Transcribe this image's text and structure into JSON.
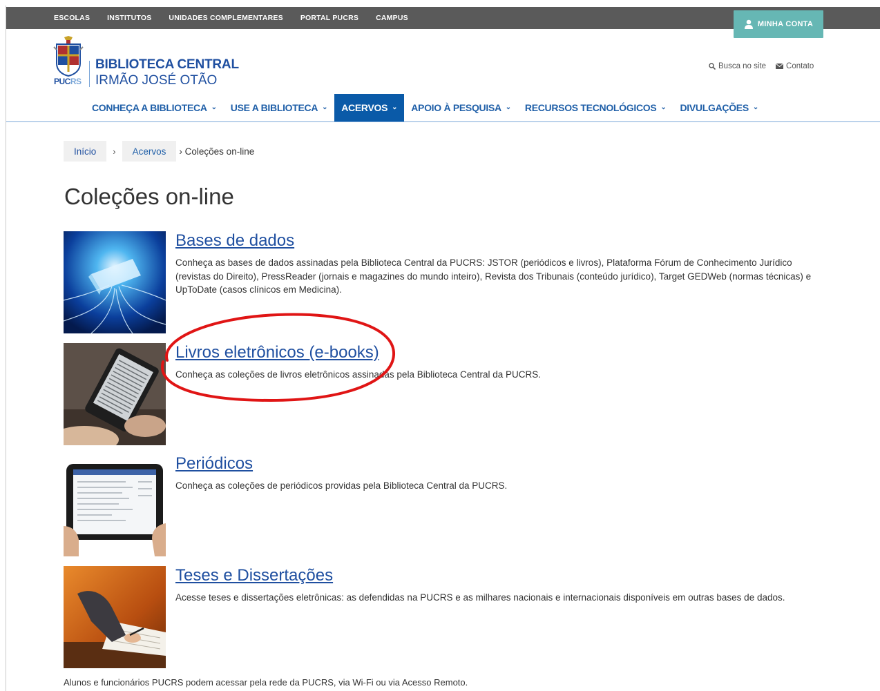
{
  "topbar": {
    "links": [
      "ESCOLAS",
      "INSTITUTOS",
      "UNIDADES COMPLEMENTARES",
      "PORTAL PUCRS",
      "CAMPUS"
    ],
    "account_button": "MINHA CONTA"
  },
  "logo": {
    "crest_label_a": "PUC",
    "crest_label_b": "RS",
    "title_line1": "BIBLIOTECA CENTRAL",
    "title_line2": "IRMÃO JOSÉ OTÃO"
  },
  "utility": {
    "search": "Busca no site",
    "contact": "Contato"
  },
  "nav": {
    "items": [
      {
        "label": "CONHEÇA A BIBLIOTECA"
      },
      {
        "label": "USE A BIBLIOTECA"
      },
      {
        "label": "ACERVOS"
      },
      {
        "label": "APOIO À PESQUISA"
      },
      {
        "label": "RECURSOS TECNOLÓGICOS"
      },
      {
        "label": "DIVULGAÇÕES"
      }
    ],
    "active_index": 2
  },
  "breadcrumb": {
    "home": "Início",
    "parent": "Acervos",
    "current": "› Coleções on-line"
  },
  "page": {
    "title": "Coleções on-line"
  },
  "collections": [
    {
      "title": "Bases de dados",
      "description": "Conheça as bases de dados assinadas pela Biblioteca Central da PUCRS: JSTOR (periódicos e livros), Plataforma Fórum de Conhecimento Jurídico (revistas do Direito), PressReader (jornais e magazines do mundo inteiro), Revista dos Tribunais (conteúdo jurídico), Target GEDWeb (normas técnicas) e UpToDate (casos clínicos em Medicina)."
    },
    {
      "title": "Livros eletrônicos (e-books)",
      "description": "Conheça as coleções de livros eletrônicos assinadas pela Biblioteca Central da PUCRS."
    },
    {
      "title": "Periódicos",
      "description": "Conheça as coleções de periódicos providas pela Biblioteca Central da PUCRS."
    },
    {
      "title": "Teses e Dissertações",
      "description": "Acesse teses e dissertações eletrônicas: as defendidas na PUCRS e as milhares nacionais e internacionais disponíveis em outras bases de dados."
    }
  ],
  "footnote": "Alunos e funcionários PUCRS podem acessar pela rede da PUCRS, via Wi-Fi ou via Acesso Remoto.",
  "colors": {
    "topbar": "#5a5a5a",
    "account_button": "#66b7b4",
    "brand_blue": "#1f4fa0",
    "nav_active": "#0a5aa8",
    "highlight_annotation": "#e01515"
  },
  "icons": {
    "account": "user-icon",
    "search": "magnifier-icon",
    "contact": "envelope-icon",
    "nav_dropdown": "chevron-down-icon"
  }
}
